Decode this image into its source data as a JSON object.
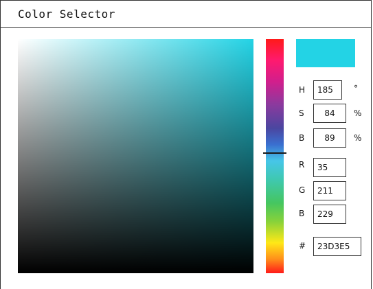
{
  "window": {
    "title": "Color Selector"
  },
  "current_color": {
    "hex_color": "#23D3E5"
  },
  "fields": {
    "hue": {
      "label": "H",
      "value": "185",
      "unit": "°"
    },
    "saturation": {
      "label": "S",
      "value": "84",
      "unit": "%"
    },
    "brightness": {
      "label": "B",
      "value": "89",
      "unit": "%"
    },
    "red": {
      "label": "R",
      "value": "35"
    },
    "green": {
      "label": "G",
      "value": "211"
    },
    "blue": {
      "label": "B",
      "value": "229"
    },
    "hex": {
      "label": "#",
      "value": "23D3E5"
    }
  },
  "hue_slider": {
    "hue_degrees": 185
  }
}
